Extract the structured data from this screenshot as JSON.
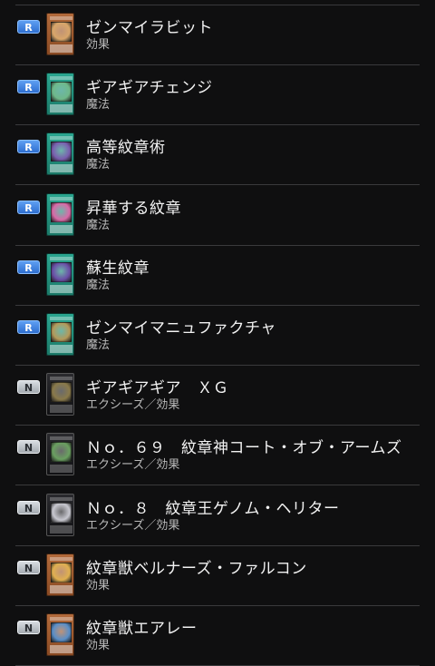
{
  "cards": [
    {
      "name": "ゼンマイラビット",
      "type": "効果",
      "rarity": "R",
      "frame": "effect",
      "art": "#d9a66a"
    },
    {
      "name": "ギアギアチェンジ",
      "type": "魔法",
      "rarity": "R",
      "frame": "spell",
      "art": "#6fb98a"
    },
    {
      "name": "高等紋章術",
      "type": "魔法",
      "rarity": "R",
      "frame": "spell",
      "art": "#7a5fb0"
    },
    {
      "name": "昇華する紋章",
      "type": "魔法",
      "rarity": "R",
      "frame": "spell",
      "art": "#d96aa8"
    },
    {
      "name": "蘇生紋章",
      "type": "魔法",
      "rarity": "R",
      "frame": "spell",
      "art": "#6b4fa8"
    },
    {
      "name": "ゼンマイマニュファクチャ",
      "type": "魔法",
      "rarity": "R",
      "frame": "spell",
      "art": "#b49a5a"
    },
    {
      "name": "ギアギアギア　ＸＧ",
      "type": "エクシーズ／効果",
      "rarity": "N",
      "frame": "xyz",
      "art": "#8a7a4a"
    },
    {
      "name": "Ｎｏ．６９　紋章神コート・オブ・アームズ",
      "type": "エクシーズ／効果",
      "rarity": "N",
      "frame": "xyz",
      "art": "#6aa060"
    },
    {
      "name": "Ｎｏ．８　紋章王ゲノム・ヘリター",
      "type": "エクシーズ／効果",
      "rarity": "N",
      "frame": "xyz",
      "art": "#c8c8d0"
    },
    {
      "name": "紋章獣ベルナーズ・ファルコン",
      "type": "効果",
      "rarity": "N",
      "frame": "effect",
      "art": "#e0b050"
    },
    {
      "name": "紋章獣エアレー",
      "type": "効果",
      "rarity": "N",
      "frame": "effect",
      "art": "#5a8fc8"
    }
  ]
}
